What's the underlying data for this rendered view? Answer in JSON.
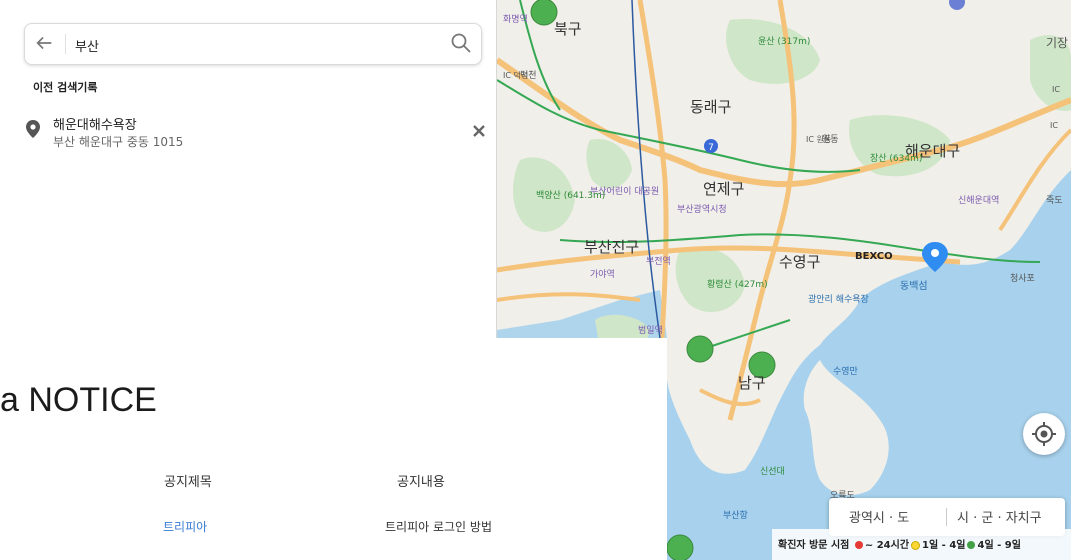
{
  "search": {
    "query": "부산"
  },
  "history": {
    "title": "이전 검색기록",
    "items": [
      {
        "name": "해운대해수욕장",
        "address": "부산 해운대구 중동 1015"
      }
    ]
  },
  "map": {
    "districts": [
      "북구",
      "동래구",
      "연제구",
      "부산진구",
      "수영구",
      "해운대구",
      "남구",
      "기장",
      "동백섬",
      "BEXCO"
    ],
    "places": [
      "화명역",
      "덕천",
      "윤산 (317m)",
      "원동",
      "장산 (634m)",
      "부산어린이 대공원",
      "부산광역시청",
      "백양산 (641.3m)",
      "부전역",
      "가야역",
      "황령산 (427m)",
      "광안리 해수욕장",
      "신해운대역",
      "청사포",
      "죽도",
      "범일역",
      "수영만",
      "신선대",
      "부산항",
      "오륙도"
    ],
    "ic_labels": [
      "IC 덕천",
      "IC 원동",
      "IC",
      "IC"
    ],
    "road_badge": "7",
    "colors": {
      "water": "#a7d1ec",
      "land": "#f1efe9",
      "park": "#cfe6c8",
      "road_main": "#f5c27a",
      "route_green": "#35a853",
      "marker": "#4caf50"
    }
  },
  "region_toggle": {
    "province": "광역시 · 도",
    "city": "시 · 군 · 자치구"
  },
  "legend": {
    "label": "확진자 방문 시점",
    "items": [
      {
        "color": "#e53935",
        "text": "~ 24시간"
      },
      {
        "color": "#fdd835",
        "text": "1일 - 4일"
      },
      {
        "color": "#43a047",
        "text": "4일 - 9일"
      }
    ]
  },
  "notice": {
    "title": "a NOTICE",
    "col_title": "공지제목",
    "col_content": "공지내용",
    "rows": [
      {
        "title": "트리피아",
        "content": "트리피아 로그인 방법"
      }
    ]
  }
}
